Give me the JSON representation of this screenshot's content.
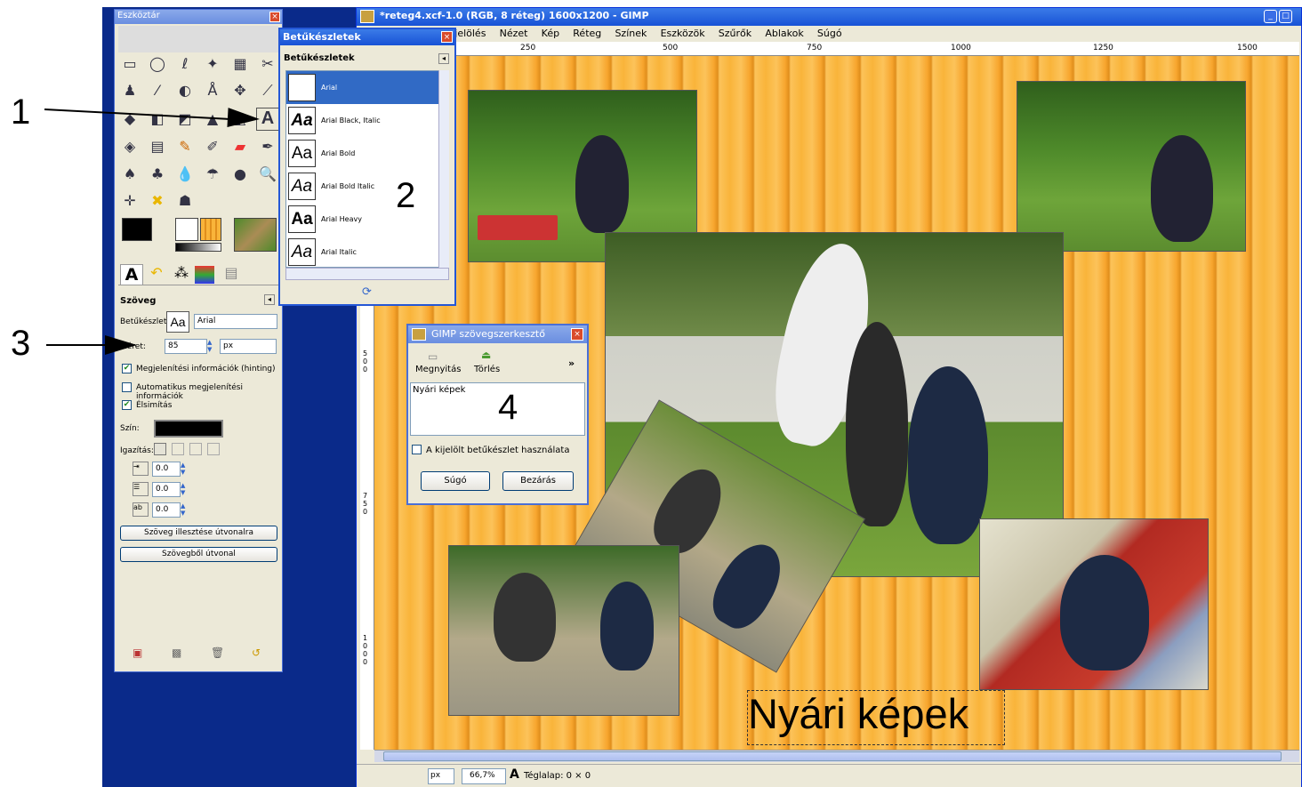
{
  "gimp_window": {
    "title": "*reteg4.xcf-1.0 (RGB, 8 réteg) 1600x1200 - GIMP",
    "menu": [
      "Kijelölés",
      "Nézet",
      "Kép",
      "Réteg",
      "Színek",
      "Eszközök",
      "Szűrők",
      "Ablakok",
      "Súgó"
    ],
    "ruler_ticks": [
      "250",
      "500",
      "750",
      "1000",
      "1250",
      "1500"
    ],
    "left_ruler_ticks": [
      "500",
      "750",
      "1000"
    ],
    "status": {
      "unit": "px",
      "zoom": "66,7%",
      "info": "Téglalap: 0 × 0"
    },
    "canvas_text": "Nyári képek"
  },
  "toolbox": {
    "title": "Eszköztár",
    "options_title": "Szöveg",
    "font_label": "Betűkészlet:",
    "font_value": "Arial",
    "size_label": "Méret:",
    "size_value": "85",
    "size_unit": "px",
    "hinting": "Megjelenítési információk (hinting)",
    "auto_hinting": "Automatikus megjelenítési információk",
    "antialias": "Élsimítás",
    "color_label": "Szín:",
    "justify_label": "Igazítás:",
    "indent": "0.0",
    "line_spacing": "0.0",
    "letter_spacing": "0.0",
    "btn_path_text": "Szöveg illesztése útvonalra",
    "btn_text_path": "Szövegből útvonal"
  },
  "fonts_dialog": {
    "title": "Betűkészletek",
    "header": "Betűkészletek",
    "fonts": [
      "Arial",
      "Arial Black, Italic",
      "Arial Bold",
      "Arial Bold Italic",
      "Arial Heavy",
      "Arial Italic"
    ]
  },
  "text_editor": {
    "title": "GIMP szövegszerkesztő",
    "open": "Megnyitás",
    "delete": "Törlés",
    "more": "»",
    "text": "Nyári képek",
    "use_font": "A kijelölt betűkészlet használata",
    "help": "Súgó",
    "close": "Bezárás"
  },
  "annotations": [
    "1",
    "2",
    "3",
    "4"
  ]
}
